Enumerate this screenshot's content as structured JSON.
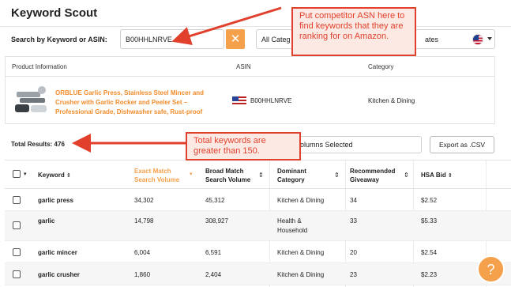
{
  "app": {
    "title": "Keyword Scout"
  },
  "search": {
    "label": "Search by Keyword or ASIN:",
    "value": "B00HHLNRVE",
    "clear_icon": "close-icon",
    "category_label": "All Categ",
    "market_label": "ates"
  },
  "product": {
    "headers": {
      "product": "Product Information",
      "asin": "ASIN",
      "category": "Category"
    },
    "name": "ORBLUE Garlic Press, Stainless Steel Mincer and Crusher with Garlic Rocker and Peeler Set – Professional Grade, Dishwasher safe, Rust-proof",
    "asin": "B00HHLNRVE",
    "category": "Kitchen & Dining"
  },
  "results": {
    "total_label": "Total Results:",
    "total_value": "476",
    "columns_label": "olumns Selected",
    "export_label": "Export as .CSV"
  },
  "table": {
    "headers": {
      "keyword": "Keyword",
      "exact_1": "Exact Match",
      "exact_2": "Search Volume",
      "broad_1": "Broad Match",
      "broad_2": "Search Volume",
      "dominant_1": "Dominant",
      "dominant_2": "Category",
      "giveaway_1": "Recommended",
      "giveaway_2": "Giveaway",
      "bid": "HSA Bid"
    },
    "rows": [
      {
        "keyword": "garlic press",
        "exact": "34,302",
        "broad": "45,312",
        "category": "Kitchen & Dining",
        "category2": "",
        "giveaway": "34",
        "bid": "$2.52"
      },
      {
        "keyword": "garlic",
        "exact": "14,798",
        "broad": "308,927",
        "category": "Health &",
        "category2": "Household",
        "giveaway": "33",
        "bid": "$5.33"
      },
      {
        "keyword": "garlic mincer",
        "exact": "6,004",
        "broad": "6,591",
        "category": "Kitchen & Dining",
        "category2": "",
        "giveaway": "20",
        "bid": "$2.54"
      },
      {
        "keyword": "garlic crusher",
        "exact": "1,860",
        "broad": "2,404",
        "category": "Kitchen & Dining",
        "category2": "",
        "giveaway": "23",
        "bid": "$2.23"
      }
    ]
  },
  "annotations": {
    "callout_1": "Put competitor ASN here to find keywords that they are ranking for on Amazon.",
    "callout_2": "Total keywords are greater than 150.",
    "arrow_color": "#e0402c"
  },
  "help": {
    "icon": "question-icon",
    "glyph": "?"
  },
  "colors": {
    "accent": "#f5a04b",
    "product_link": "#f08c2b",
    "callout": "#e0402c"
  }
}
